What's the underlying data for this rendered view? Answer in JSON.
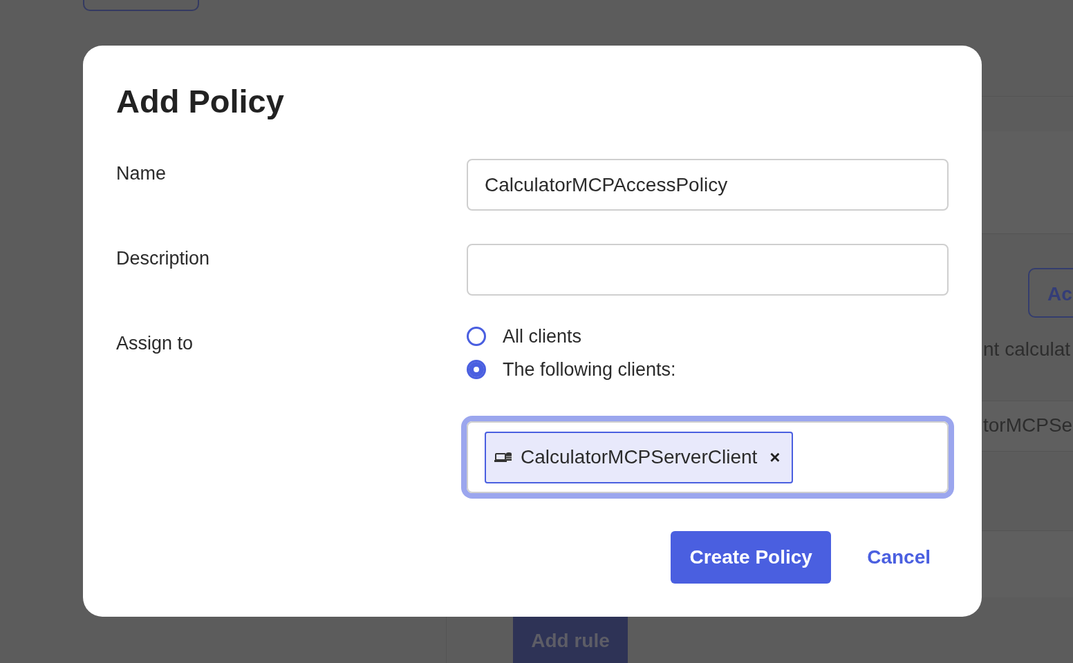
{
  "background": {
    "side_button": "Ac",
    "side_text": "nt calculat",
    "side_row": "torMCPSe",
    "add_rule_button": "Add rule"
  },
  "dialog": {
    "title": "Add Policy",
    "name": {
      "label": "Name",
      "value": "CalculatorMCPAccessPolicy"
    },
    "description": {
      "label": "Description"
    },
    "assign_to": {
      "label": "Assign to",
      "options": [
        {
          "label": "All clients",
          "selected": false
        },
        {
          "label": "The following clients:",
          "selected": true
        }
      ],
      "picker": {
        "focused": true,
        "chips": [
          {
            "label": "CalculatorMCPServerClient",
            "remove": "×"
          }
        ]
      }
    },
    "buttons": {
      "primary": "Create Policy",
      "secondary": "Cancel"
    }
  }
}
